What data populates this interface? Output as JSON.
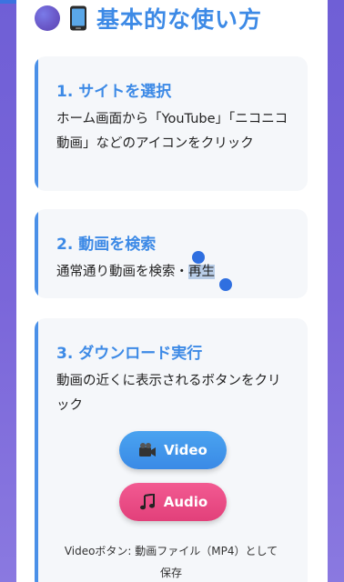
{
  "header": {
    "title": "基本的な使い方"
  },
  "steps": [
    {
      "title": "1. サイトを選択",
      "text": "ホーム画面から「YouTube」「ニコニコ動画」などのアイコンをクリック"
    },
    {
      "title": "2. 動画を検索",
      "text_before": "通常通り動画を検索・",
      "text_selected": "再生"
    },
    {
      "title": "3. ダウンロード実行",
      "text": "動画の近くに表示されるボタンをクリック",
      "video_button": "Video",
      "audio_button": "Audio",
      "note_line1": "Videoボタン: 動画ファイル（MP4）として",
      "note_line2": "保存"
    }
  ],
  "colors": {
    "accent": "#3d8ae6",
    "video": "#3a8ae6",
    "audio": "#e2407a"
  }
}
